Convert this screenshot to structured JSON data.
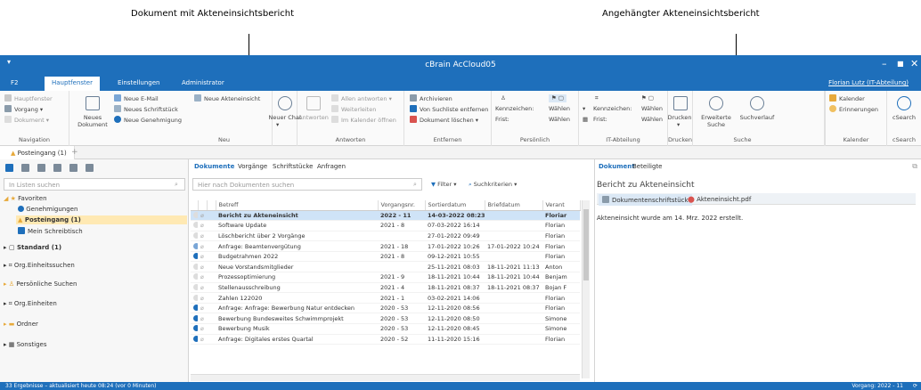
{
  "callouts": {
    "left": "Dokument mit Akteneinsichtsbericht",
    "right": "Angehängter Akteneinsichtsbericht"
  },
  "window": {
    "title": "cBrain AcCloud05",
    "controls": [
      "–",
      "■",
      "✕"
    ]
  },
  "menu": {
    "tabs": [
      "F2",
      "Hauptfenster",
      "Einstellungen",
      "Administrator"
    ],
    "user": "Florian Lutz (IT-Abteilung)"
  },
  "ribbon": {
    "navigation": {
      "items": [
        "Hauptfenster",
        "Vorgang",
        "Dokument"
      ],
      "label": "Navigation"
    },
    "neu": {
      "big": "Neues Dokument",
      "items": [
        "Neue E-Mail",
        "Neues Schriftstück",
        "Neue Genehmigung"
      ],
      "akten": "Neue Akteneinsicht",
      "label": "Neu"
    },
    "chat": {
      "big": "Neuer Chat"
    },
    "antworten": {
      "big": "Antworten",
      "items": [
        "Allen antworten",
        "Weiterleiten",
        "Im Kalender öffnen"
      ],
      "label": "Antworten"
    },
    "entfernen": {
      "items": [
        "Archivieren",
        "Von Suchliste entfernen",
        "Dokument löschen"
      ],
      "label": "Entfernen"
    },
    "persoenlich": {
      "items": [
        "Kennzeichen:",
        "Frist:"
      ],
      "values": [
        "Wählen",
        "Wählen"
      ],
      "label": "Persönlich"
    },
    "it": {
      "items": [
        "Kennzeichen:",
        "Frist:"
      ],
      "values": [
        "Wählen",
        "Wählen"
      ],
      "label": "IT-Abteilung"
    },
    "drucken": {
      "big": "Drucken",
      "label": "Drucken"
    },
    "suche": {
      "items": [
        "Erweiterte Suche",
        "Suchverlauf"
      ],
      "label": "Suche"
    },
    "kalender": {
      "items": [
        "Kalender",
        "Erinnerungen"
      ],
      "label": "Kalender"
    },
    "csearch": {
      "big": "cSearch",
      "label": "cSearch"
    }
  },
  "openTab": "Posteingang (1)",
  "left": {
    "search_placeholder": "In Listen suchen",
    "tree": [
      "Favoriten",
      "Genehmigungen",
      "Posteingang (1)",
      "Mein Schreibtisch",
      "Standard (1)",
      "Org.Einheitssuchen",
      "Persönliche Suchen",
      "Org.Einheiten",
      "Ordner",
      "Sonstiges"
    ]
  },
  "center": {
    "tabs": [
      "Dokumente",
      "Vorgänge",
      "Schriftstücke",
      "Anfragen"
    ],
    "search_placeholder": "Hier nach Dokumenten suchen",
    "filter": "Filter",
    "criteria": "Suchkriterien",
    "columns": [
      "Betreff",
      "Vorgangsnr.",
      "Sortierdatum",
      "Briefdatum",
      "Verant"
    ],
    "rows": [
      {
        "betreff": "Bericht zu Akteneinsicht",
        "nr": "2022 - 11",
        "sort": "14-03-2022 08:23",
        "brief": "",
        "ver": "Floriar"
      },
      {
        "betreff": "Software Update",
        "nr": "2021 - 8",
        "sort": "07-03-2022 16:14",
        "brief": "",
        "ver": "Florian"
      },
      {
        "betreff": "Löschbericht über 2 Vorgänge",
        "nr": "",
        "sort": "27-01-2022 09:49",
        "brief": "",
        "ver": "Florian"
      },
      {
        "betreff": "Anfrage: Beamtenvergütung",
        "nr": "2021 - 18",
        "sort": "17-01-2022 10:26",
        "brief": "17-01-2022 10:24",
        "ver": "Florian"
      },
      {
        "betreff": "Budgetrahmen 2022",
        "nr": "2021 - 8",
        "sort": "09-12-2021 10:55",
        "brief": "",
        "ver": "Florian"
      },
      {
        "betreff": "Neue Vorstandsmitglieder",
        "nr": "",
        "sort": "25-11-2021 08:03",
        "brief": "18-11-2021 11:13",
        "ver": "Anton"
      },
      {
        "betreff": "Prozessoptimierung",
        "nr": "2021 - 9",
        "sort": "18-11-2021 10:44",
        "brief": "18-11-2021 10:44",
        "ver": "Benjam"
      },
      {
        "betreff": "Stellenausschreibung",
        "nr": "2021 - 4",
        "sort": "18-11-2021 08:37",
        "brief": "18-11-2021 08:37",
        "ver": "Bojan F"
      },
      {
        "betreff": "Zahlen 122020",
        "nr": "2021 - 1",
        "sort": "03-02-2021 14:06",
        "brief": "",
        "ver": "Florian"
      },
      {
        "betreff": "Anfrage: Anfrage: Bewerbung Natur entdecken",
        "nr": "2020 - 53",
        "sort": "12-11-2020 08:56",
        "brief": "",
        "ver": "Florian"
      },
      {
        "betreff": "Bewerbung Bundesweites Schwimmprojekt",
        "nr": "2020 - 53",
        "sort": "12-11-2020 08:50",
        "brief": "",
        "ver": "Simone"
      },
      {
        "betreff": "Bewerbung Musik",
        "nr": "2020 - 53",
        "sort": "12-11-2020 08:45",
        "brief": "",
        "ver": "Simone"
      },
      {
        "betreff": "Anfrage: Digitales erstes Quartal",
        "nr": "2020 - 52",
        "sort": "11-11-2020 15:16",
        "brief": "",
        "ver": "Florian"
      }
    ]
  },
  "right": {
    "tabs": [
      "Dokument",
      "Beteiligte"
    ],
    "title": "Bericht zu Akteneinsicht",
    "subtabs": [
      "Dokumentenschriftstück",
      "Akteneinsicht.pdf"
    ],
    "body": "Akteneinsicht wurde am 14. Mrz. 2022 erstellt."
  },
  "status": {
    "left": "33 Ergebnisse – aktualisiert heute 08:24 (vor 0 Minuten)",
    "right": "Vorgang: 2022 - 11"
  },
  "colors": {
    "accent": "#1e6fbb",
    "selected_row": "#cfe3f7",
    "selected_tree": "#ffe9b3"
  }
}
